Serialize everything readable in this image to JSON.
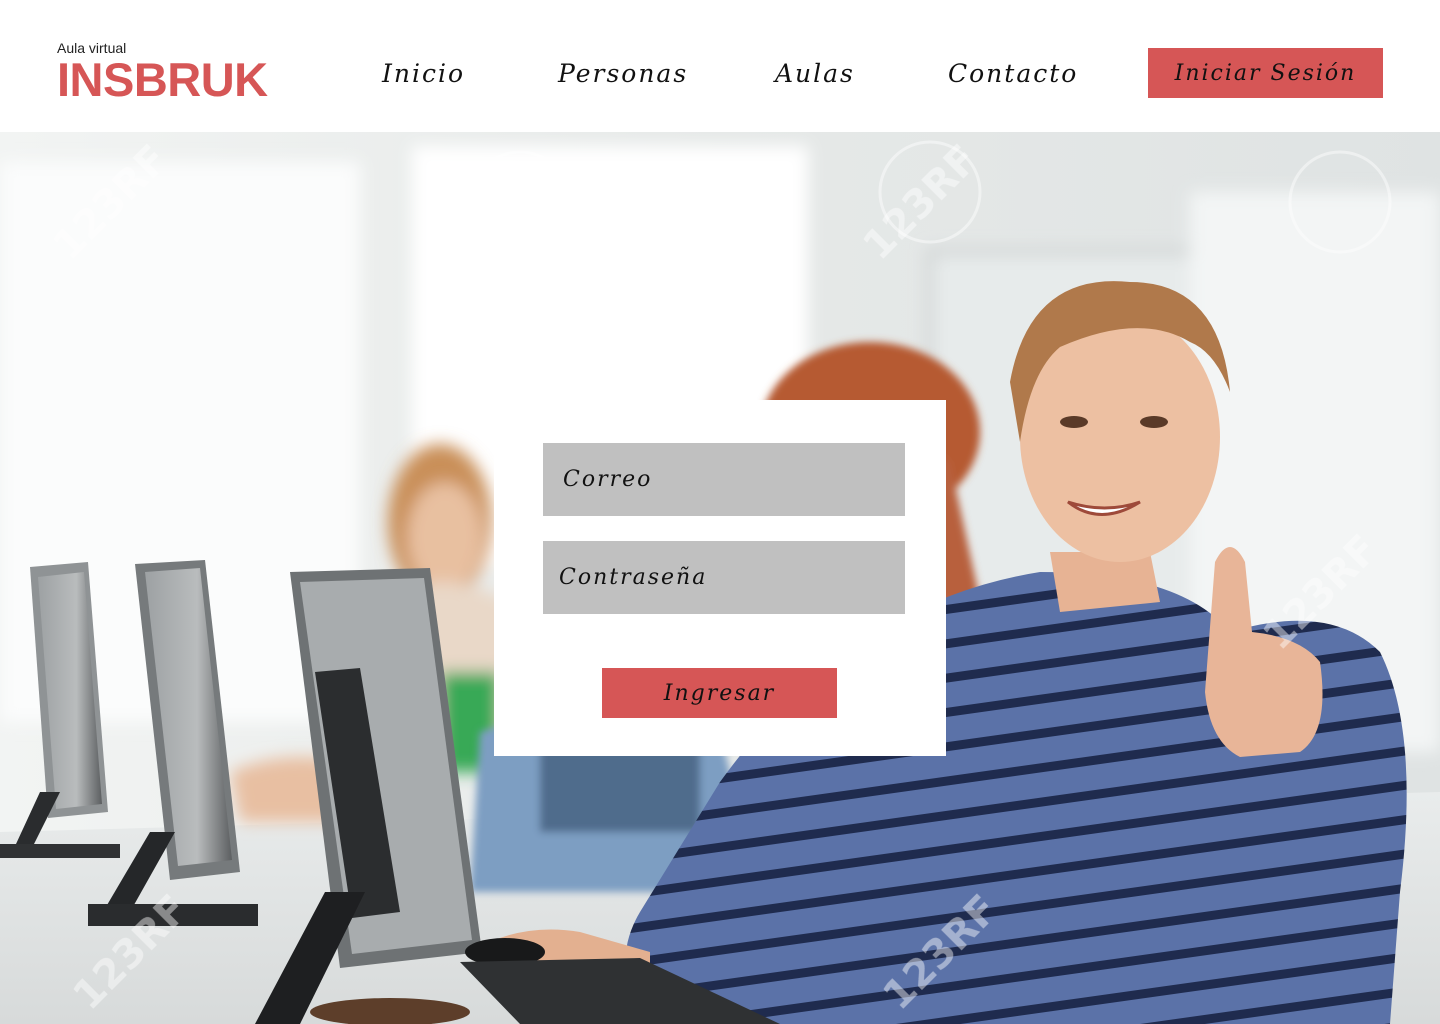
{
  "brand": {
    "subtitle": "Aula virtual",
    "name": "INSBRUK"
  },
  "nav": {
    "items": [
      {
        "label": "Inicio"
      },
      {
        "label": "Personas"
      },
      {
        "label": "Aulas"
      },
      {
        "label": "Contacto"
      }
    ],
    "login_button": "Iniciar Sesión"
  },
  "login_form": {
    "email_placeholder": "Correo",
    "password_placeholder": "Contraseña",
    "submit_label": "Ingresar"
  },
  "hero": {
    "watermark": "123RF"
  },
  "colors": {
    "accent": "#d65656",
    "field_bg": "#c0c0c0"
  }
}
